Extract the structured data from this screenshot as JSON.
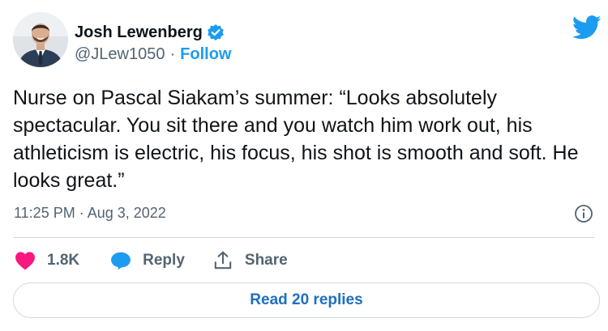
{
  "author": {
    "display_name": "Josh Lewenberg",
    "handle": "@JLew1050",
    "separator": "·",
    "follow_label": "Follow",
    "verified_icon": "verified-badge-icon",
    "avatar_icon": "avatar-photo"
  },
  "tweet": {
    "text": "Nurse on Pascal Siakam’s summer: “Looks absolutely spectacular. You sit there and you watch him work out, his athleticism is electric, his focus, his shot is smooth and soft. He looks great.”",
    "timestamp": "11:25 PM · Aug 3, 2022"
  },
  "actions": {
    "like_count": "1.8K",
    "reply_label": "Reply",
    "share_label": "Share"
  },
  "replies": {
    "read_label": "Read 20 replies"
  },
  "colors": {
    "brand": "#1d9bf0",
    "like": "#f91880",
    "text": "#0f1419",
    "muted": "#536471",
    "border": "#cfd9de"
  },
  "icons": {
    "brand": "twitter-bird-icon",
    "info": "info-icon",
    "like": "heart-icon",
    "reply": "speech-bubble-icon",
    "share": "share-upload-icon"
  }
}
